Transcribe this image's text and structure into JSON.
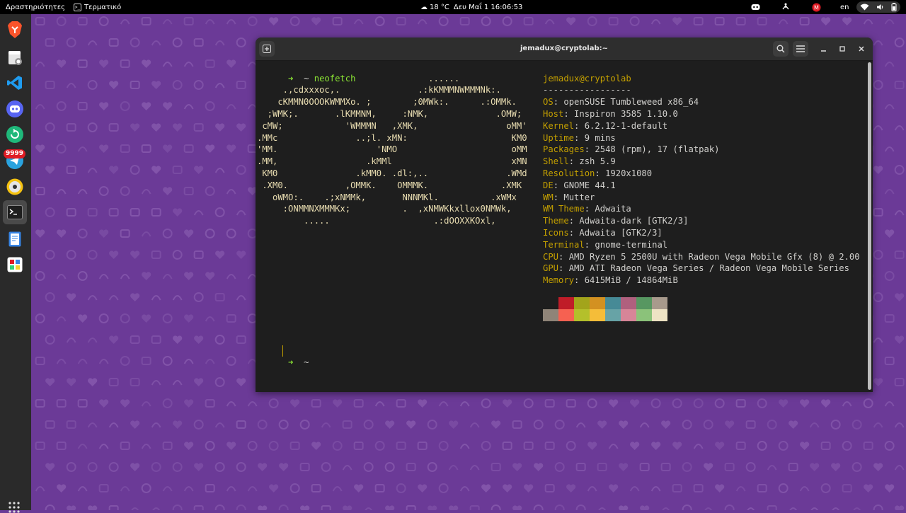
{
  "topbar": {
    "activities": "Δραστηριότητες",
    "app_name": "Τερματικό",
    "weather": "18 °C",
    "datetime": "Δευ Μαΐ 1  16:06:53",
    "language": "en"
  },
  "dock": {
    "items": [
      "brave-browser",
      "file-manager",
      "vscode",
      "discord",
      "git-client",
      "telegram",
      "rhythmbox",
      "terminal",
      "text-editor",
      "software"
    ],
    "telegram_badge": "9999"
  },
  "terminal": {
    "title": "jemadux@cryptolab:~",
    "prompt_tilde": "~",
    "command": "neofetch",
    "ascii_art": [
      "                                 ......",
      "     .,cdxxxoc,.               .:kKMMMNWMMMNk:.",
      "    cKMMN0OOOKWMMXo. ;        ;0MWk:.      .:OMMk.",
      "  ;WMK;.       .lKMMNM,     :NMK,             .OMW;",
      " cMW;            'WMMMN   ,XMK,                 oMM'",
      ".MMc               ..;l. xMN:                    KM0",
      "'MM.                   'NMO                      oMM",
      ".MM,                 .kMMl                       xMN",
      " KM0               .kMM0. .dl:,..               .WMd",
      " .XM0.           ,OMMK.    OMMMK.              .XMK",
      "   oWMO:.    .;xNMMk,       NNNMKl.          .xWMx",
      "     :ONMMNXMMMKx;          .  ,xNMWKkxllox0NMWk,",
      "         .....                    .:dOOXXKOxl,"
    ],
    "user_host": "jemadux@cryptolab",
    "separator": "-----------------",
    "info": [
      {
        "key": "OS",
        "value": "openSUSE Tumbleweed x86_64"
      },
      {
        "key": "Host",
        "value": "Inspiron 3585 1.10.0"
      },
      {
        "key": "Kernel",
        "value": "6.2.12-1-default"
      },
      {
        "key": "Uptime",
        "value": "9 mins"
      },
      {
        "key": "Packages",
        "value": "2548 (rpm), 17 (flatpak)"
      },
      {
        "key": "Shell",
        "value": "zsh 5.9"
      },
      {
        "key": "Resolution",
        "value": "1920x1080"
      },
      {
        "key": "DE",
        "value": "GNOME 44.1"
      },
      {
        "key": "WM",
        "value": "Mutter"
      },
      {
        "key": "WM Theme",
        "value": "Adwaita"
      },
      {
        "key": "Theme",
        "value": "Adwaita-dark [GTK2/3]"
      },
      {
        "key": "Icons",
        "value": "Adwaita [GTK2/3]"
      },
      {
        "key": "Terminal",
        "value": "gnome-terminal"
      },
      {
        "key": "CPU",
        "value": "AMD Ryzen 5 2500U with Radeon Vega Mobile Gfx (8) @ 2.00"
      },
      {
        "key": "GPU",
        "value": "AMD ATI Radeon Vega Series / Radeon Vega Mobile Series"
      },
      {
        "key": "Memory",
        "value": "6415MiB / 14864MiB"
      }
    ],
    "palette_top": [
      "#1e1e1e",
      "#c01c28",
      "#a2a41b",
      "#d39121",
      "#468a96",
      "#b0607e",
      "#579761",
      "#a89a8c"
    ],
    "palette_bottom": [
      "#8f8478",
      "#f66151",
      "#b4c02b",
      "#f5bd39",
      "#67a3a6",
      "#d78598",
      "#8bc27a",
      "#eee3c4"
    ]
  }
}
